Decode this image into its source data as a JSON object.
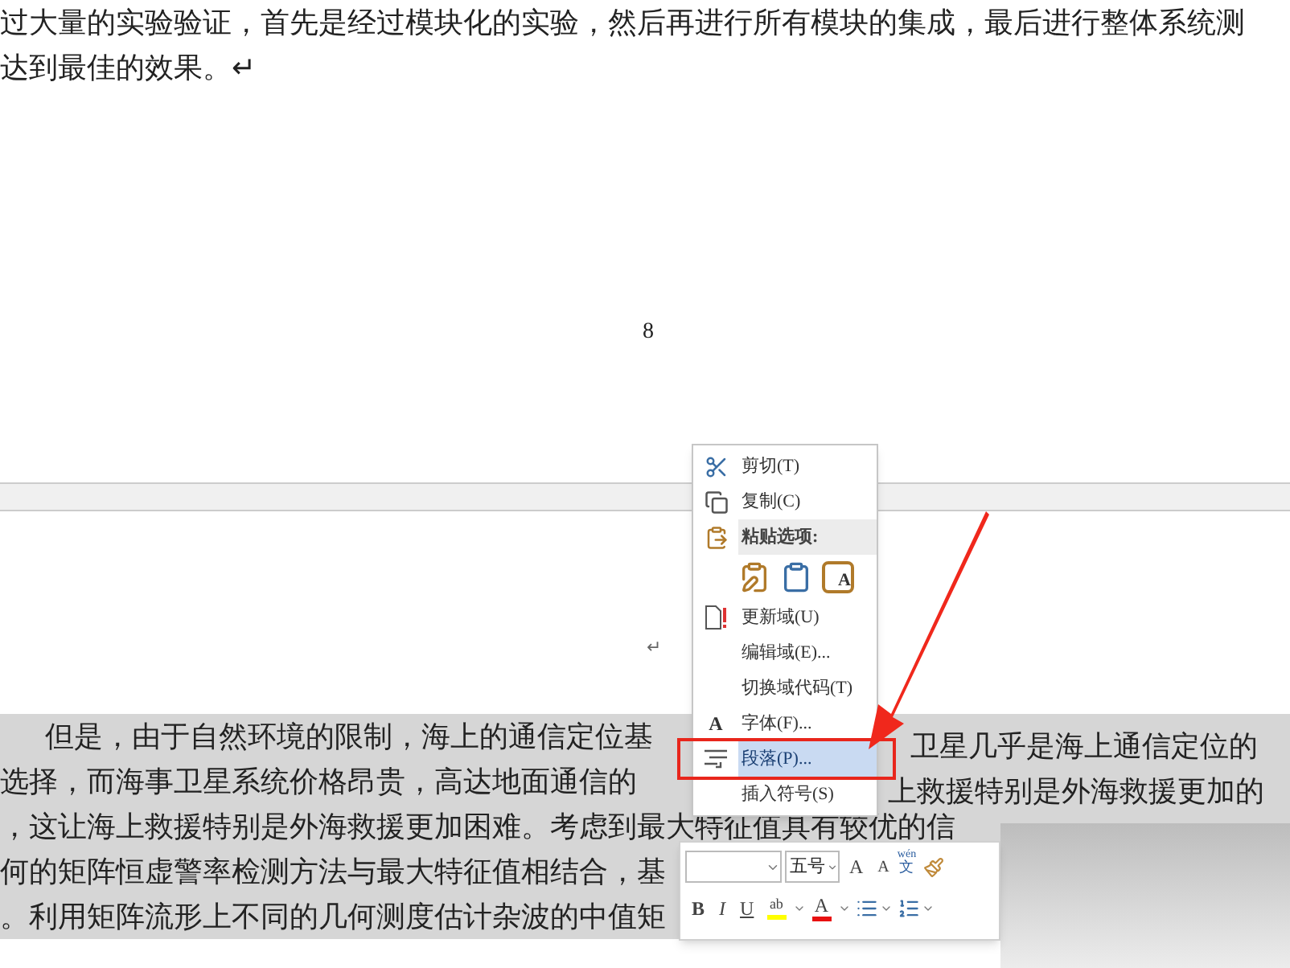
{
  "page_top": {
    "lines": [
      "过大量的实验验证，首先是经过模块化的实验，然后再进行所有模块的集成，最后进行整体系统测",
      "达到最佳的效果。↵"
    ],
    "page_number": "8"
  },
  "page_bottom": {
    "empty_paragraph_mark": "↵",
    "lines": [
      {
        "left": "但是，由于自然环境的限制，海上的通信定位基",
        "right": "卫星几乎是海上通信定位的"
      },
      {
        "left": "选择，而海事卫星系统价格昂贵，高达地面通信的",
        "right": "上救援特别是外海救援更加的"
      },
      {
        "left": "，这让海上救援特别是外海救援更加困难。考虑到最大特征值具有较优的信"
      },
      {
        "left": "何的矩阵恒虚警率检测方法与最大特征值相结合，基"
      },
      {
        "left": "。利用矩阵流形上不同的几何测度估计杂波的中值矩"
      }
    ]
  },
  "context_menu": {
    "items": [
      {
        "kind": "item",
        "label": "剪切(T)",
        "selected": false
      },
      {
        "kind": "item",
        "label": "复制(C)",
        "selected": false
      },
      {
        "kind": "header",
        "label": "粘贴选项:"
      },
      {
        "kind": "paste-row",
        "letter": "A"
      },
      {
        "kind": "item",
        "label": "更新域(U)",
        "selected": false
      },
      {
        "kind": "item",
        "label": "编辑域(E)...",
        "selected": false
      },
      {
        "kind": "item",
        "label": "切换域代码(T)",
        "selected": false
      },
      {
        "kind": "item",
        "icon_text": "A",
        "label": "字体(F)...",
        "selected": false
      },
      {
        "kind": "item",
        "label": "段落(P)...",
        "selected": true
      },
      {
        "kind": "item",
        "label": "插入符号(S)",
        "selected": false
      }
    ]
  },
  "mini_toolbar": {
    "font_size": "五号",
    "grow_font": "A",
    "shrink_font": "A",
    "phonetic_top": "wén",
    "phonetic_bottom": "文",
    "bold": "B",
    "italic": "I",
    "underline": "U",
    "highlight": "ab",
    "font_color": "A"
  }
}
